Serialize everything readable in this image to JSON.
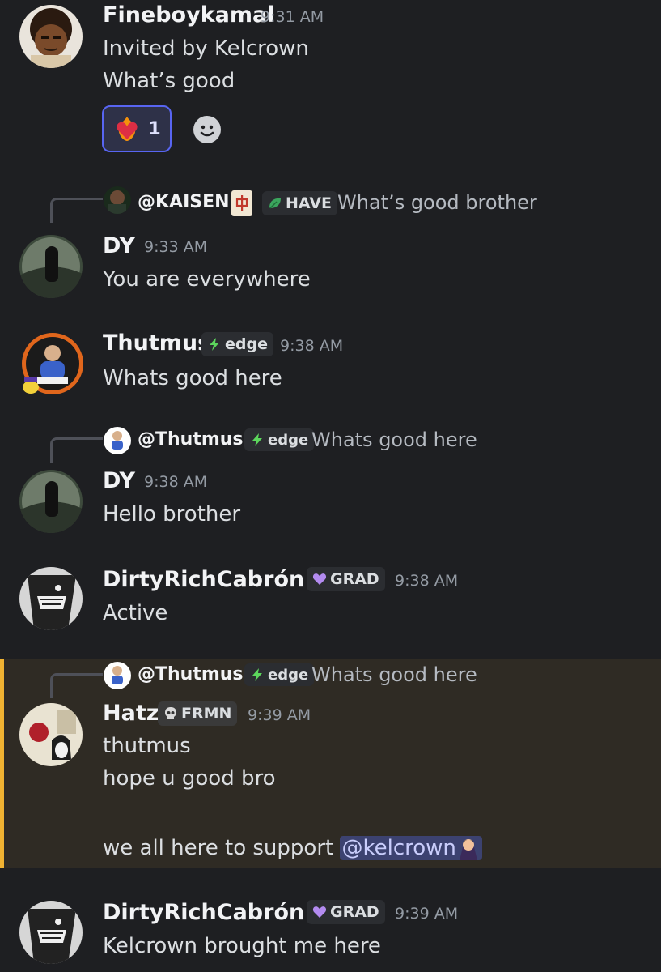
{
  "messages": {
    "m1": {
      "author": "Fineboykamal",
      "time": "9:31 AM",
      "lines": [
        "Invited by Kelcrown",
        "What’s good"
      ],
      "reaction_count": "1"
    },
    "m2": {
      "reply_author": "@KAISEN",
      "reply_tag": "HAVE",
      "reply_text": "What’s good brother",
      "author": "DY",
      "time": "9:33 AM",
      "text": "You are everywhere"
    },
    "m3": {
      "author": "Thutmus",
      "tag": "edge",
      "time": "9:38 AM",
      "text": "Whats good here"
    },
    "m4": {
      "reply_author": "@Thutmus",
      "reply_tag": "edge",
      "reply_text": "Whats good here",
      "author": "DY",
      "time": "9:38 AM",
      "text": "Hello brother"
    },
    "m5": {
      "author": "DirtyRichCabrón ./",
      "tag": "GRAD",
      "time": "9:38 AM",
      "text": "Active"
    },
    "m6": {
      "reply_author": "@Thutmus",
      "reply_tag": "edge",
      "reply_text": "Whats good here",
      "author": "Hatz",
      "tag": "FRMN",
      "time": "9:39 AM",
      "lines": [
        "thutmus",
        "hope u good bro"
      ],
      "text_prefix": "we all here to support ",
      "mention": "@kelcrown"
    },
    "m7": {
      "author": "DirtyRichCabrón ./",
      "tag": "GRAD",
      "time": "9:39 AM",
      "text": "Kelcrown brought me here"
    }
  },
  "colors": {
    "background": "#1e1f22",
    "highlight": "#2f2b24",
    "highlight_bar": "#f0b232",
    "mention_bg": "#3c4270",
    "reaction_border": "#5865f2"
  },
  "icons": [
    "heart-on-fire-icon",
    "add-reaction-icon",
    "mahjong-tile-icon",
    "leaf-icon",
    "lightning-icon",
    "purple-heart-icon",
    "skull-icon",
    "vampire-icon"
  ]
}
